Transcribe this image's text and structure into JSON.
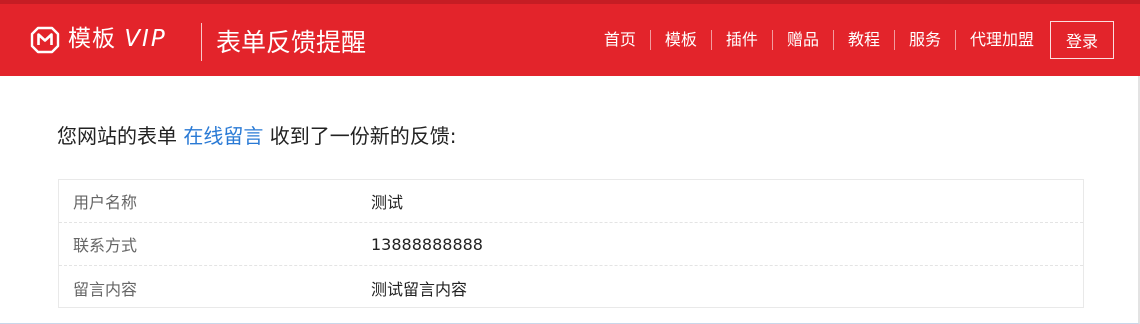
{
  "header": {
    "logo_text": "模板",
    "logo_suffix": "VIP",
    "page_title": "表单反馈提醒",
    "nav": [
      "首页",
      "模板",
      "插件",
      "赠品",
      "教程",
      "服务",
      "代理加盟"
    ],
    "login_label": "登录"
  },
  "message": {
    "prefix": "您网站的表单",
    "form_link": "在线留言",
    "suffix": "收到了一份新的反馈:"
  },
  "feedback_table": [
    {
      "label": "用户名称",
      "value": "测试"
    },
    {
      "label": "联系方式",
      "value": "13888888888"
    },
    {
      "label": "留言内容",
      "value": "测试留言内容"
    }
  ],
  "colors": {
    "brand_red": "#e3242b",
    "link_blue": "#2a7ad5"
  }
}
